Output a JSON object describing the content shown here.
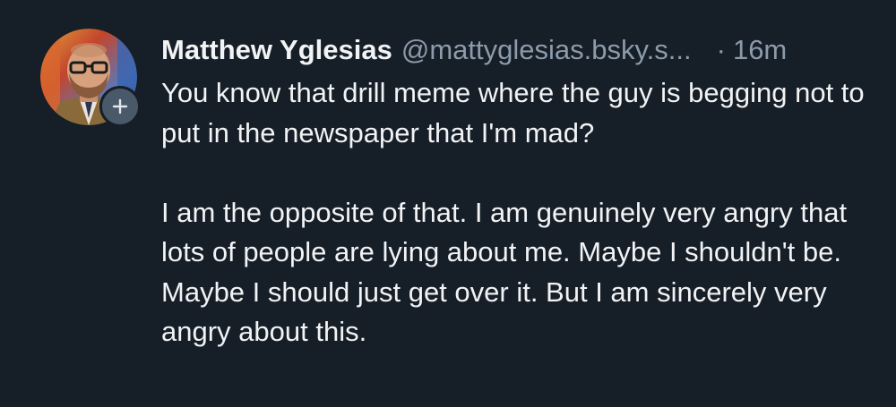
{
  "post": {
    "author": {
      "display_name": "Matthew Yglesias",
      "handle": "@mattyglesias.bsky.s..."
    },
    "separator": "·",
    "timestamp": "16m",
    "paragraphs": [
      "You know that drill meme where the guy is begging not to put in the newspaper that I'm mad?",
      "I am the opposite of that. I am genuinely very angry that lots of people are lying about me. Maybe I shouldn't be. Maybe I should just get over it. But I am sincerely very angry about this."
    ]
  },
  "icons": {
    "avatar": "user-avatar-photo",
    "follow": "plus-icon"
  },
  "colors": {
    "background": "#161e27",
    "primary_text": "#f1f3f5",
    "secondary_text": "#8c9bab",
    "follow_button": "#4a5969"
  }
}
